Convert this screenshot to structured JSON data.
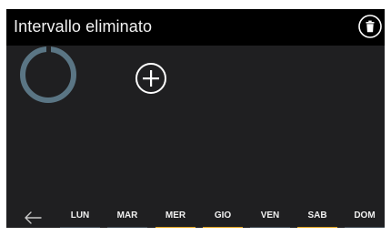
{
  "header": {
    "title": "Intervallo eliminato",
    "delete_icon": "trash-icon"
  },
  "main": {
    "ring_color": "#5a7584",
    "add_icon": "plus-circle-icon"
  },
  "footer": {
    "back_icon": "arrow-left-icon",
    "accent_color": "#e0a21d",
    "days": [
      {
        "label": "LUN",
        "selected": false
      },
      {
        "label": "MAR",
        "selected": false
      },
      {
        "label": "MER",
        "selected": true
      },
      {
        "label": "GIO",
        "selected": true
      },
      {
        "label": "VEN",
        "selected": false
      },
      {
        "label": "SAB",
        "selected": true
      },
      {
        "label": "DOM",
        "selected": false
      }
    ]
  }
}
